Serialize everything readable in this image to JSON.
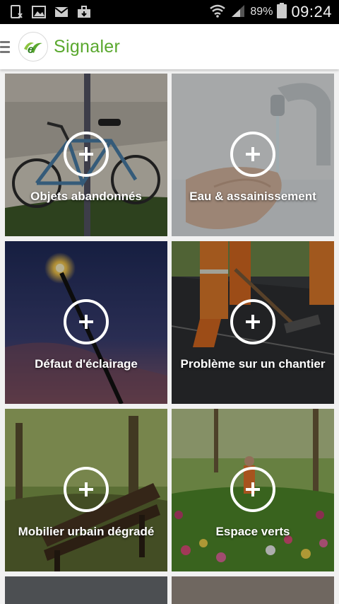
{
  "status_bar": {
    "battery_percent": "89%",
    "time": "09:24",
    "icons": [
      "sim-icon",
      "gallery-icon",
      "mail-icon",
      "briefcase-icon",
      "wifi-icon",
      "signal-icon",
      "battery-icon"
    ]
  },
  "app_bar": {
    "title": "Signaler",
    "menu_icon": "hamburger-icon",
    "accent_color": "#5aa82e"
  },
  "tiles": [
    {
      "label": "Objets abandonnés",
      "icon": "add-icon"
    },
    {
      "label": "Eau & assainissement",
      "icon": "add-icon"
    },
    {
      "label": "Défaut d'éclairage",
      "icon": "add-icon"
    },
    {
      "label": "Problème sur un chantier",
      "icon": "add-icon"
    },
    {
      "label": "Mobilier urbain dégradé",
      "icon": "add-icon"
    },
    {
      "label": "Espace verts",
      "icon": "add-icon"
    }
  ]
}
